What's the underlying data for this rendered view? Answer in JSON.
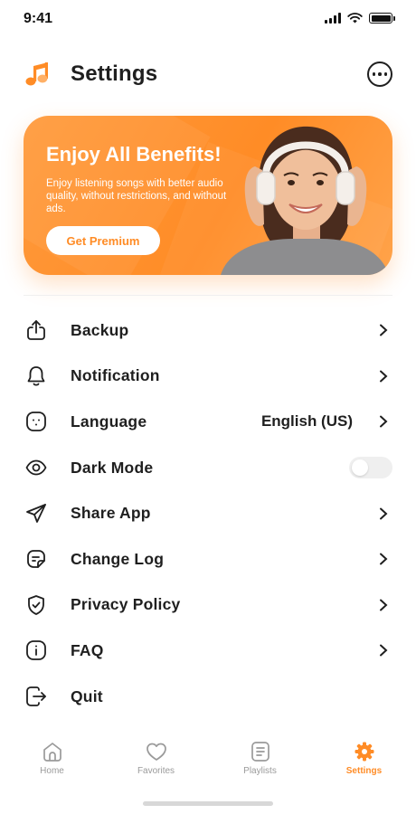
{
  "status_bar": {
    "time": "9:41"
  },
  "header": {
    "title": "Settings",
    "logo_icon": "music-note-icon",
    "more_icon": "more-horizontal-icon"
  },
  "banner": {
    "title": "Enjoy All Benefits!",
    "description": "Enjoy listening songs with better audio quality, without restrictions, and without ads.",
    "button_label": "Get Premium",
    "image": "woman-with-headphones"
  },
  "settings": [
    {
      "label": "Backup",
      "icon": "upload-icon",
      "control": "chevron"
    },
    {
      "label": "Notification",
      "icon": "bell-icon",
      "control": "chevron"
    },
    {
      "label": "Language",
      "icon": "language-icon",
      "control": "chevron",
      "value": "English (US)"
    },
    {
      "label": "Dark Mode",
      "icon": "eye-icon",
      "control": "toggle",
      "enabled": false
    },
    {
      "label": "Share App",
      "icon": "send-icon",
      "control": "chevron"
    },
    {
      "label": "Change Log",
      "icon": "document-icon",
      "control": "chevron"
    },
    {
      "label": "Privacy Policy",
      "icon": "shield-check-icon",
      "control": "chevron"
    },
    {
      "label": "FAQ",
      "icon": "info-icon",
      "control": "chevron"
    },
    {
      "label": "Quit",
      "icon": "logout-icon",
      "control": "none"
    }
  ],
  "bottom_nav": [
    {
      "label": "Home",
      "icon": "home-icon",
      "active": false
    },
    {
      "label": "Favorites",
      "icon": "heart-icon",
      "active": false
    },
    {
      "label": "Playlists",
      "icon": "playlist-icon",
      "active": false
    },
    {
      "label": "Settings",
      "icon": "gear-icon",
      "active": true
    }
  ],
  "colors": {
    "accent": "#ff8c26",
    "text": "#1f1f1f",
    "muted": "#9a9a9a"
  }
}
